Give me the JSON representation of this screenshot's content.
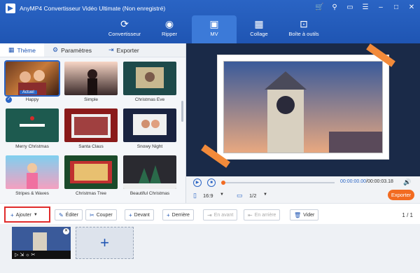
{
  "app": {
    "title": "AnyMP4 Convertisseur Vidéo Ultimate (Non enregistré)"
  },
  "nav": [
    {
      "label": "Convertisseur",
      "icon": "converter-icon"
    },
    {
      "label": "Ripper",
      "icon": "ripper-icon"
    },
    {
      "label": "MV",
      "icon": "mv-icon"
    },
    {
      "label": "Collage",
      "icon": "collage-icon"
    },
    {
      "label": "Boîte à outils",
      "icon": "toolbox-icon"
    }
  ],
  "subtabs": {
    "theme": "Thème",
    "settings": "Paramètres",
    "export": "Exporter"
  },
  "themes": [
    {
      "name": "Happy",
      "badge": "Actuel"
    },
    {
      "name": "Simple"
    },
    {
      "name": "Christmas Eve"
    },
    {
      "name": "Merry Christmas"
    },
    {
      "name": "Santa Claus"
    },
    {
      "name": "Snowy Night"
    },
    {
      "name": "Stripes & Waves"
    },
    {
      "name": "Christmas Tree"
    },
    {
      "name": "Beautiful Christmas"
    }
  ],
  "player": {
    "current": "00:00:00.00",
    "total": "00:00:03.18",
    "separator": "/",
    "ratio": "16:9",
    "page": "1/2",
    "export": "Exporter"
  },
  "toolbar": {
    "add": "Ajouter",
    "edit": "Éditer",
    "cut": "Couper",
    "front": "Devant",
    "back": "Derrière",
    "forward": "En avant",
    "backward": "En arrière",
    "clear": "Vider",
    "page": "1 / 1"
  },
  "colors": {
    "brand": "#1f55b3",
    "accent": "#f26b21",
    "highlight": "#e02b2b"
  }
}
